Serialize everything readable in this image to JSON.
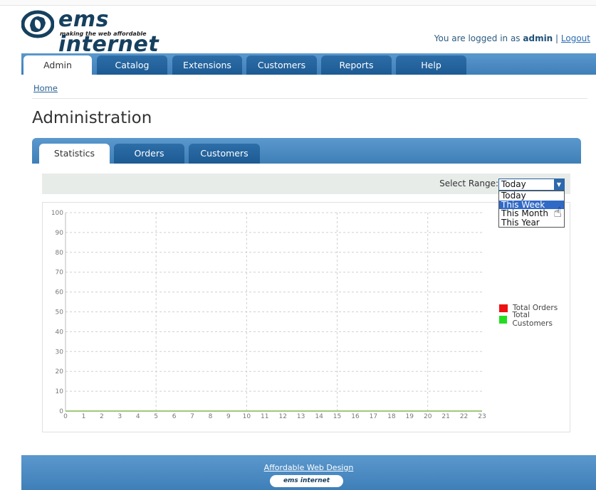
{
  "header": {
    "brand": "ems internet",
    "tagline": "making the web affordable",
    "login_prefix": "You are logged in as ",
    "username": "admin",
    "separator": " | ",
    "logout_label": "Logout"
  },
  "nav": {
    "tabs": [
      {
        "label": "Admin",
        "active": true
      },
      {
        "label": "Catalog",
        "active": false
      },
      {
        "label": "Extensions",
        "active": false
      },
      {
        "label": "Customers",
        "active": false
      },
      {
        "label": "Reports",
        "active": false
      },
      {
        "label": "Help",
        "active": false
      }
    ]
  },
  "breadcrumb": {
    "home": "Home"
  },
  "page": {
    "title": "Administration"
  },
  "subtabs": [
    {
      "label": "Statistics",
      "active": true
    },
    {
      "label": "Orders",
      "active": false
    },
    {
      "label": "Customers",
      "active": false
    }
  ],
  "range": {
    "label": "Select Range:",
    "selected": "Today",
    "options": [
      "Today",
      "This Week",
      "This Month",
      "This Year"
    ],
    "highlighted": "This Week"
  },
  "chart_data": {
    "type": "line",
    "title": "",
    "xlabel": "",
    "ylabel": "",
    "x": [
      0,
      1,
      2,
      3,
      4,
      5,
      6,
      7,
      8,
      9,
      10,
      11,
      12,
      13,
      14,
      15,
      16,
      17,
      18,
      19,
      20,
      21,
      22,
      23
    ],
    "ylim": [
      0,
      100
    ],
    "yticks": [
      0,
      10,
      20,
      30,
      40,
      50,
      60,
      70,
      80,
      90,
      100
    ],
    "grid": true,
    "legend_position": "right",
    "series": [
      {
        "name": "Total Orders",
        "color": "#ee1111",
        "values": [
          0,
          0,
          0,
          0,
          0,
          0,
          0,
          0,
          0,
          0,
          0,
          0,
          0,
          0,
          0,
          0,
          0,
          0,
          0,
          0,
          0,
          0,
          0,
          0
        ]
      },
      {
        "name": "Total Customers",
        "color": "#22dd22",
        "values": [
          0,
          0,
          0,
          0,
          0,
          0,
          0,
          0,
          0,
          0,
          0,
          0,
          0,
          0,
          0,
          0,
          0,
          0,
          0,
          0,
          0,
          0,
          0,
          0
        ]
      }
    ]
  },
  "footer": {
    "link": "Affordable Web Design",
    "logo_text": "ems internet"
  },
  "colors": {
    "brand_dark": "#16405f",
    "nav_blue": "#4b8bc2",
    "tab_dark": "#1d5a93"
  }
}
